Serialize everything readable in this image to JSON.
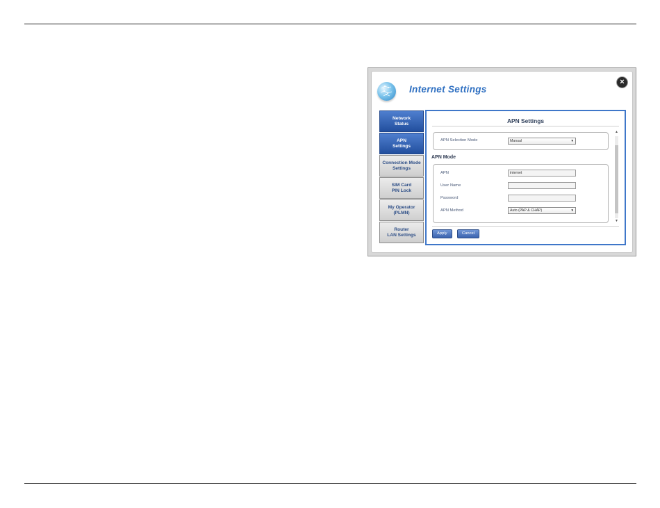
{
  "dialog": {
    "title": "Internet Settings",
    "close_glyph": "×"
  },
  "sidebar": {
    "items": [
      {
        "line1": "Network",
        "line2": "Status",
        "active": true
      },
      {
        "line1": "APN",
        "line2": "Settings",
        "active": true
      },
      {
        "line1": "Connection Mode",
        "line2": "Settings",
        "active": false
      },
      {
        "line1": "SIM Card",
        "line2": "PIN Lock",
        "active": false
      },
      {
        "line1": "My Operator",
        "line2": "(PLMN)",
        "active": false
      },
      {
        "line1": "Router",
        "line2": "LAN Settings",
        "active": false
      }
    ]
  },
  "apn": {
    "heading": "APN Settings",
    "selection_mode_label": "APN Selection Mode",
    "selection_mode_value": "Manual",
    "mode_heading": "APN Mode",
    "apn_label": "APN",
    "apn_value": "internet",
    "username_label": "User Name",
    "username_value": "",
    "password_label": "Password",
    "password_value": "",
    "method_label": "APN Method",
    "method_value": "Auto (PAP & CHAP)"
  },
  "buttons": {
    "apply": "Apply",
    "cancel": "Cancel"
  },
  "icons": {
    "logo": "globe-icon",
    "close": "close-icon",
    "caret": "caret-down-icon",
    "scroll_up": "scroll-up-arrow-icon",
    "scroll_down": "scroll-down-arrow-icon"
  },
  "colors": {
    "accent": "#2e6fc1",
    "nav_active": "#2d5aa8",
    "content_border": "#3f77c9"
  }
}
